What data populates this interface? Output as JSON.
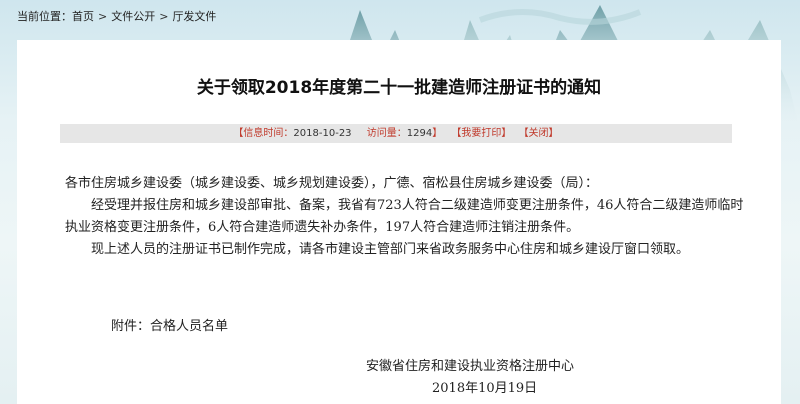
{
  "breadcrumb": {
    "prefix": "当前位置：",
    "items": [
      "首页",
      "文件公开",
      "厅发文件"
    ],
    "separator": ">"
  },
  "article": {
    "title": "关于领取2018年度第二十一批建造师注册证书的通知",
    "info": {
      "time_label": "【信息时间：",
      "time_value": "2018-10-23",
      "views_label": "访问量：",
      "views_value": "1294",
      "views_close": "】",
      "print": "【我要打印】",
      "close": "【关闭】"
    },
    "salutation": "各市住房城乡建设委（城乡建设委、城乡规划建设委），广德、宿松县住房城乡建设委（局）：",
    "para1": "经受理并报住房和城乡建设部审批、备案，我省有723人符合二级建造师变更注册条件，46人符合二级建造师临时执业资格变更注册条件，6人符合建造师遗失补办条件，197人符合建造师注销注册条件。",
    "para2": "现上述人员的注册证书已制作完成，请各市建设主管部门来省政务服务中心住房和城乡建设厅窗口领取。",
    "attachment": "附件：合格人员名单",
    "signature": "安徽省住房和建设执业资格注册中心",
    "date": "2018年10月19日"
  },
  "colors": {
    "info_accent": "#c0392b",
    "info_bar_bg": "#e6e6e6",
    "card_bg": "#ffffff"
  }
}
